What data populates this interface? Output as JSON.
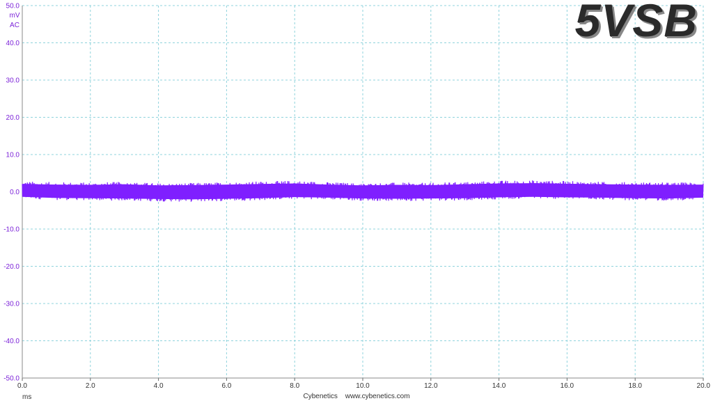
{
  "chart_data": {
    "type": "line",
    "title": "5VSB",
    "xlabel": "ms",
    "ylabel": "mV",
    "ylabel_sub": "AC",
    "xlim": [
      0.0,
      20.0
    ],
    "ylim": [
      -50.0,
      50.0
    ],
    "x_ticks": [
      "0.0",
      "2.0",
      "4.0",
      "6.0",
      "8.0",
      "10.0",
      "12.0",
      "14.0",
      "16.0",
      "18.0",
      "20.0"
    ],
    "y_ticks": [
      "50.0",
      "40.0",
      "30.0",
      "20.0",
      "10.0",
      "0.0",
      "-10.0",
      "-20.0",
      "-30.0",
      "-40.0",
      "-50.0"
    ],
    "grid": true,
    "series": [
      {
        "color": "#7f1fff",
        "envelope": {
          "x": [
            0.0,
            1.0,
            2.0,
            3.0,
            4.0,
            5.0,
            6.0,
            7.0,
            8.0,
            9.0,
            10.0,
            11.0,
            12.0,
            13.0,
            14.0,
            15.0,
            16.0,
            17.0,
            18.0,
            19.0,
            20.0
          ],
          "upper": [
            2.8,
            2.6,
            2.5,
            2.7,
            2.3,
            2.4,
            2.6,
            2.8,
            3.0,
            2.6,
            2.3,
            2.5,
            2.4,
            2.7,
            3.0,
            3.1,
            2.9,
            2.7,
            2.6,
            2.5,
            2.6
          ],
          "lower": [
            -1.8,
            -2.2,
            -2.3,
            -2.4,
            -2.6,
            -2.7,
            -2.5,
            -2.3,
            -1.9,
            -2.1,
            -2.4,
            -2.5,
            -2.4,
            -2.3,
            -2.0,
            -1.8,
            -2.0,
            -2.1,
            -2.3,
            -2.4,
            -2.1
          ]
        }
      }
    ]
  },
  "footer": {
    "brand": "Cybenetics",
    "url": "www.cybenetics.com"
  }
}
